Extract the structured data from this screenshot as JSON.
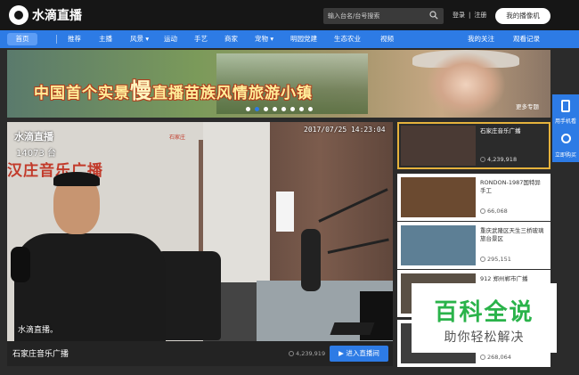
{
  "app": {
    "logo_text": "水滴直播"
  },
  "header": {
    "search_placeholder": "输入台名/台号搜索",
    "login": "登录",
    "sep": "|",
    "register": "注册",
    "my_stream_button": "我的播像机"
  },
  "nav": {
    "items": [
      "首页",
      "推荐",
      "主播",
      "风景 ▾",
      "运动",
      "手艺",
      "商家",
      "宠物 ▾",
      "明园党建",
      "生态农业",
      "视频"
    ],
    "right_items": [
      "我的关注",
      "观看记录"
    ]
  },
  "banner": {
    "text_before": "中国首个实景",
    "text_big": "慢",
    "text_after": "直播苗族风情旅游小镇",
    "more_label": "更多专题",
    "dots": 8,
    "active_dot": 1
  },
  "player": {
    "watermark_top": "水滴直播",
    "viewers_overlay": "14073 台",
    "timestamp": "2017/07/25  14:23:04",
    "wall_sign": "汉庄音乐广播",
    "wall_small": "石家庄",
    "watermark_bottom": "水滴直播。",
    "title": "石家庄音乐广播",
    "viewers": "4,239,919",
    "enter_button": "▶ 进入直播间"
  },
  "list": {
    "items": [
      {
        "title": "石家庄音乐广播",
        "count": "4,239,918",
        "active": true,
        "thumb": "#4a3a34"
      },
      {
        "title": "RONDON-1987国特异手工",
        "count": "66,068",
        "active": false,
        "thumb": "#6b4a30"
      },
      {
        "title": "重庆武隆区天生三桥玻璃旅台景区",
        "count": "295,151",
        "active": false,
        "thumb": "#5d7f95"
      },
      {
        "title": "912 郑州郸市广播",
        "count": "",
        "active": false,
        "thumb": "#5a5045"
      },
      {
        "title": "",
        "count": "268,064",
        "active": false,
        "thumb": "#3e3e3e"
      }
    ]
  },
  "side_tabs": [
    {
      "label": "用手机看"
    },
    {
      "label": "立即购买"
    }
  ],
  "overlay": {
    "title": "百科全说",
    "subtitle": "助你轻松解决"
  },
  "colors": {
    "accent": "#2d7be5",
    "active_border": "#e5b23c",
    "overlay_green": "#2ab34a"
  }
}
